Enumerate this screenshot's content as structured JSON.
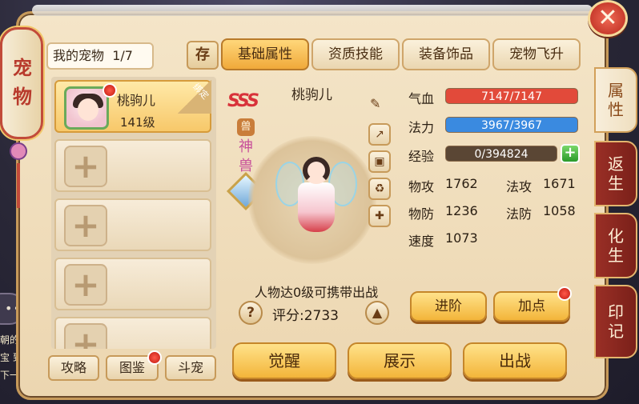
{
  "background": {
    "chat_icon": "•••",
    "side_text": "朝的宝 到下一"
  },
  "lantern": {
    "label": "宠物"
  },
  "close_button": {
    "glyph": "✕"
  },
  "header": {
    "pet_list_title": "我的宠物",
    "pet_count": "1/7",
    "store_label": "存",
    "tabs": [
      "基础属性",
      "资质技能",
      "装备饰品",
      "宠物飞升"
    ]
  },
  "side_tabs": [
    "属性",
    "返生",
    "化生",
    "印记"
  ],
  "pet_list": {
    "selected": {
      "name": "桃驹儿",
      "level": "141级",
      "bind_label": "绑定"
    }
  },
  "bottom_left_buttons": [
    "攻略",
    "图鉴",
    "斗宠"
  ],
  "pet": {
    "name": "桃驹儿",
    "rank": "SSS",
    "race_icon": "兽",
    "beast_type": "神兽",
    "carry_note": "人物达0级可携带出战",
    "score_label": "评分:",
    "score_value": "2733"
  },
  "stats": {
    "hp_label": "气血",
    "hp_text": "7147/7147",
    "hp_fraction": 1.0,
    "mp_label": "法力",
    "mp_text": "3967/3967",
    "mp_fraction": 1.0,
    "exp_label": "经验",
    "exp_text": "0/394824",
    "exp_fraction": 0.0,
    "phys_atk_label": "物攻",
    "phys_atk": "1762",
    "mag_atk_label": "法攻",
    "mag_atk": "1671",
    "phys_def_label": "物防",
    "phys_def": "1236",
    "mag_def_label": "法防",
    "mag_def": "1058",
    "speed_label": "速度",
    "speed": "1073"
  },
  "actions": {
    "advance": "进阶",
    "add_points": "加点",
    "awaken": "觉醒",
    "show": "展示",
    "deploy": "出战"
  },
  "colors": {
    "hp_bar": "#e24a3a",
    "mp_bar": "#3a8ae0",
    "exp_bar": "#5a4634",
    "accent_gold": "#f3b53a",
    "accent_red": "#c24b3a"
  }
}
